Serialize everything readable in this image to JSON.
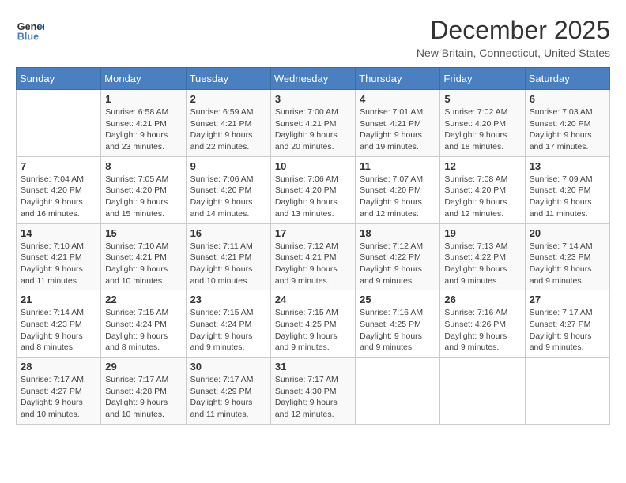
{
  "header": {
    "logo_general": "General",
    "logo_blue": "Blue",
    "month_title": "December 2025",
    "location": "New Britain, Connecticut, United States"
  },
  "calendar": {
    "days_of_week": [
      "Sunday",
      "Monday",
      "Tuesday",
      "Wednesday",
      "Thursday",
      "Friday",
      "Saturday"
    ],
    "weeks": [
      [
        {
          "day": "",
          "info": ""
        },
        {
          "day": "1",
          "info": "Sunrise: 6:58 AM\nSunset: 4:21 PM\nDaylight: 9 hours\nand 23 minutes."
        },
        {
          "day": "2",
          "info": "Sunrise: 6:59 AM\nSunset: 4:21 PM\nDaylight: 9 hours\nand 22 minutes."
        },
        {
          "day": "3",
          "info": "Sunrise: 7:00 AM\nSunset: 4:21 PM\nDaylight: 9 hours\nand 20 minutes."
        },
        {
          "day": "4",
          "info": "Sunrise: 7:01 AM\nSunset: 4:21 PM\nDaylight: 9 hours\nand 19 minutes."
        },
        {
          "day": "5",
          "info": "Sunrise: 7:02 AM\nSunset: 4:20 PM\nDaylight: 9 hours\nand 18 minutes."
        },
        {
          "day": "6",
          "info": "Sunrise: 7:03 AM\nSunset: 4:20 PM\nDaylight: 9 hours\nand 17 minutes."
        }
      ],
      [
        {
          "day": "7",
          "info": "Sunrise: 7:04 AM\nSunset: 4:20 PM\nDaylight: 9 hours\nand 16 minutes."
        },
        {
          "day": "8",
          "info": "Sunrise: 7:05 AM\nSunset: 4:20 PM\nDaylight: 9 hours\nand 15 minutes."
        },
        {
          "day": "9",
          "info": "Sunrise: 7:06 AM\nSunset: 4:20 PM\nDaylight: 9 hours\nand 14 minutes."
        },
        {
          "day": "10",
          "info": "Sunrise: 7:06 AM\nSunset: 4:20 PM\nDaylight: 9 hours\nand 13 minutes."
        },
        {
          "day": "11",
          "info": "Sunrise: 7:07 AM\nSunset: 4:20 PM\nDaylight: 9 hours\nand 12 minutes."
        },
        {
          "day": "12",
          "info": "Sunrise: 7:08 AM\nSunset: 4:20 PM\nDaylight: 9 hours\nand 12 minutes."
        },
        {
          "day": "13",
          "info": "Sunrise: 7:09 AM\nSunset: 4:20 PM\nDaylight: 9 hours\nand 11 minutes."
        }
      ],
      [
        {
          "day": "14",
          "info": "Sunrise: 7:10 AM\nSunset: 4:21 PM\nDaylight: 9 hours\nand 11 minutes."
        },
        {
          "day": "15",
          "info": "Sunrise: 7:10 AM\nSunset: 4:21 PM\nDaylight: 9 hours\nand 10 minutes."
        },
        {
          "day": "16",
          "info": "Sunrise: 7:11 AM\nSunset: 4:21 PM\nDaylight: 9 hours\nand 10 minutes."
        },
        {
          "day": "17",
          "info": "Sunrise: 7:12 AM\nSunset: 4:21 PM\nDaylight: 9 hours\nand 9 minutes."
        },
        {
          "day": "18",
          "info": "Sunrise: 7:12 AM\nSunset: 4:22 PM\nDaylight: 9 hours\nand 9 minutes."
        },
        {
          "day": "19",
          "info": "Sunrise: 7:13 AM\nSunset: 4:22 PM\nDaylight: 9 hours\nand 9 minutes."
        },
        {
          "day": "20",
          "info": "Sunrise: 7:14 AM\nSunset: 4:23 PM\nDaylight: 9 hours\nand 9 minutes."
        }
      ],
      [
        {
          "day": "21",
          "info": "Sunrise: 7:14 AM\nSunset: 4:23 PM\nDaylight: 9 hours\nand 8 minutes."
        },
        {
          "day": "22",
          "info": "Sunrise: 7:15 AM\nSunset: 4:24 PM\nDaylight: 9 hours\nand 8 minutes."
        },
        {
          "day": "23",
          "info": "Sunrise: 7:15 AM\nSunset: 4:24 PM\nDaylight: 9 hours\nand 9 minutes."
        },
        {
          "day": "24",
          "info": "Sunrise: 7:15 AM\nSunset: 4:25 PM\nDaylight: 9 hours\nand 9 minutes."
        },
        {
          "day": "25",
          "info": "Sunrise: 7:16 AM\nSunset: 4:25 PM\nDaylight: 9 hours\nand 9 minutes."
        },
        {
          "day": "26",
          "info": "Sunrise: 7:16 AM\nSunset: 4:26 PM\nDaylight: 9 hours\nand 9 minutes."
        },
        {
          "day": "27",
          "info": "Sunrise: 7:17 AM\nSunset: 4:27 PM\nDaylight: 9 hours\nand 9 minutes."
        }
      ],
      [
        {
          "day": "28",
          "info": "Sunrise: 7:17 AM\nSunset: 4:27 PM\nDaylight: 9 hours\nand 10 minutes."
        },
        {
          "day": "29",
          "info": "Sunrise: 7:17 AM\nSunset: 4:28 PM\nDaylight: 9 hours\nand 10 minutes."
        },
        {
          "day": "30",
          "info": "Sunrise: 7:17 AM\nSunset: 4:29 PM\nDaylight: 9 hours\nand 11 minutes."
        },
        {
          "day": "31",
          "info": "Sunrise: 7:17 AM\nSunset: 4:30 PM\nDaylight: 9 hours\nand 12 minutes."
        },
        {
          "day": "",
          "info": ""
        },
        {
          "day": "",
          "info": ""
        },
        {
          "day": "",
          "info": ""
        }
      ]
    ]
  }
}
